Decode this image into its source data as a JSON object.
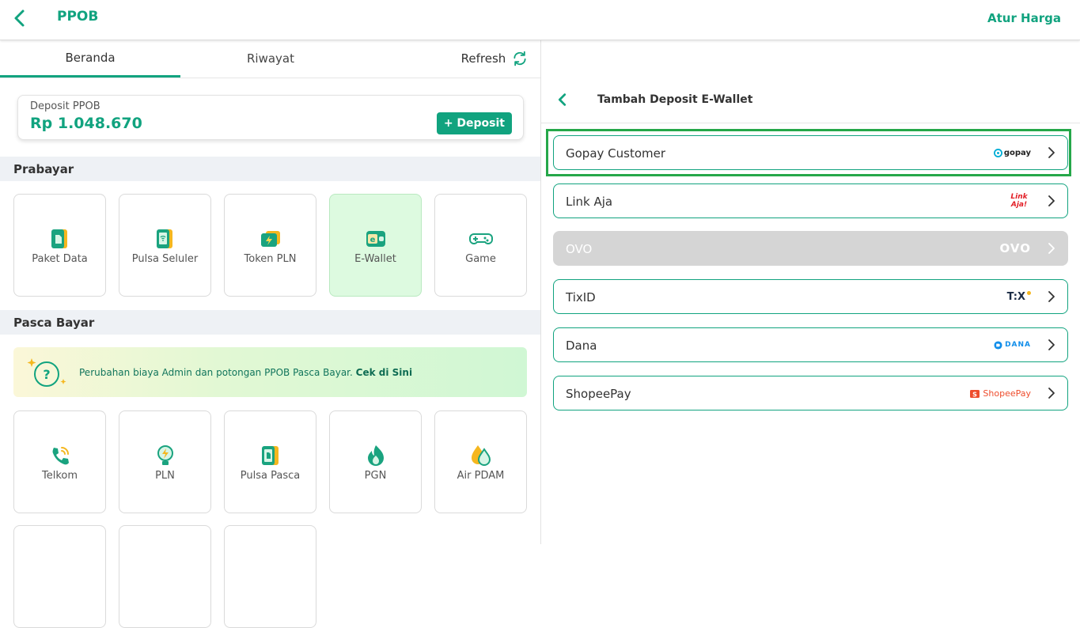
{
  "header": {
    "title": "PPOB",
    "action": "Atur Harga"
  },
  "tabs": {
    "home": "Beranda",
    "history": "Riwayat",
    "refresh": "Refresh"
  },
  "deposit": {
    "label": "Deposit PPOB",
    "amount": "Rp 1.048.670",
    "button": "+ Deposit"
  },
  "prabayar": {
    "title": "Prabayar",
    "items": [
      "Paket Data",
      "Pulsa Seluler",
      "Token PLN",
      "E-Wallet",
      "Game"
    ]
  },
  "pasca": {
    "title": "Pasca Bayar",
    "banner_text": "Perubahan biaya Admin dan potongan PPOB Pasca Bayar.",
    "banner_link": "Cek di Sini",
    "items": [
      "Telkom",
      "PLN",
      "Pulsa Pasca",
      "PGN",
      "Air PDAM"
    ]
  },
  "panel": {
    "title": "Tambah Deposit E-Wallet",
    "wallets": [
      {
        "name": "Gopay Customer",
        "logo_text": "gopay"
      },
      {
        "name": "Link Aja",
        "logo_text": "LinkAja!"
      },
      {
        "name": "OVO",
        "logo_text": "OVO"
      },
      {
        "name": "TixID",
        "logo_text": "T:X"
      },
      {
        "name": "Dana",
        "logo_text": "DANA"
      },
      {
        "name": "ShopeePay",
        "logo_text": "ShopeePay"
      }
    ]
  },
  "colors": {
    "accent": "#11a37f",
    "highlight": "#25a749",
    "active_tile": "#ddfae0",
    "disabled": "#d5d5d5"
  }
}
